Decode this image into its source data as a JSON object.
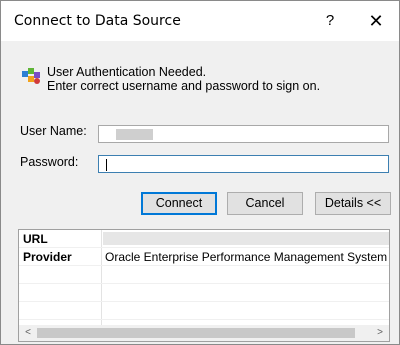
{
  "window": {
    "title": "Connect to Data Source",
    "help_glyph": "?",
    "close_glyph": "✕"
  },
  "message": {
    "icon": "user-auth-icon",
    "line1": "User Authentication Needed.",
    "line2": "Enter correct username and password to sign on."
  },
  "form": {
    "username_label": "User Name:",
    "username_value": "",
    "password_label": "Password:",
    "password_value": ""
  },
  "buttons": {
    "connect": "Connect",
    "cancel": "Cancel",
    "details": "Details <<"
  },
  "details_grid": {
    "rows": [
      {
        "key": "URL",
        "value": ""
      },
      {
        "key": "Provider",
        "value": "Oracle Enterprise Performance Management System Worksp"
      }
    ]
  },
  "scrollbar": {
    "left_glyph": "<",
    "right_glyph": ">"
  }
}
